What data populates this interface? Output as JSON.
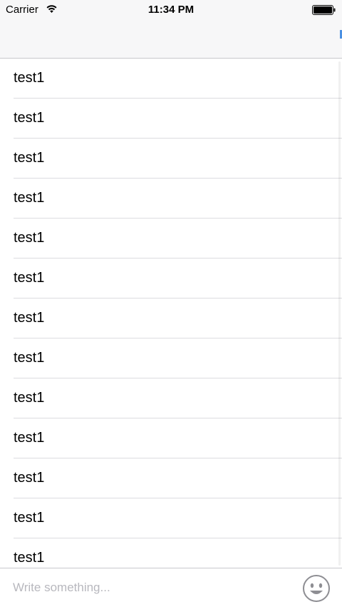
{
  "status_bar": {
    "carrier": "Carrier",
    "time": "11:34 PM",
    "wifi_icon": "wifi-icon",
    "battery_icon": "battery-icon"
  },
  "nav_bar": {
    "title": ""
  },
  "list": {
    "items": [
      {
        "label": "test1"
      },
      {
        "label": "test1"
      },
      {
        "label": "test1"
      },
      {
        "label": "test1"
      },
      {
        "label": "test1"
      },
      {
        "label": "test1"
      },
      {
        "label": "test1"
      },
      {
        "label": "test1"
      },
      {
        "label": "test1"
      },
      {
        "label": "test1"
      },
      {
        "label": "test1"
      },
      {
        "label": "test1"
      },
      {
        "label": "test1"
      }
    ]
  },
  "input_bar": {
    "placeholder": "Write something...",
    "value": "",
    "emoji_icon": "smiley-face-icon"
  },
  "colors": {
    "nav_background": "#f7f7f8",
    "separator": "#dcdce0",
    "placeholder_text": "#b8b8be",
    "text": "#000000",
    "emoji_gray": "#8e8e93"
  }
}
